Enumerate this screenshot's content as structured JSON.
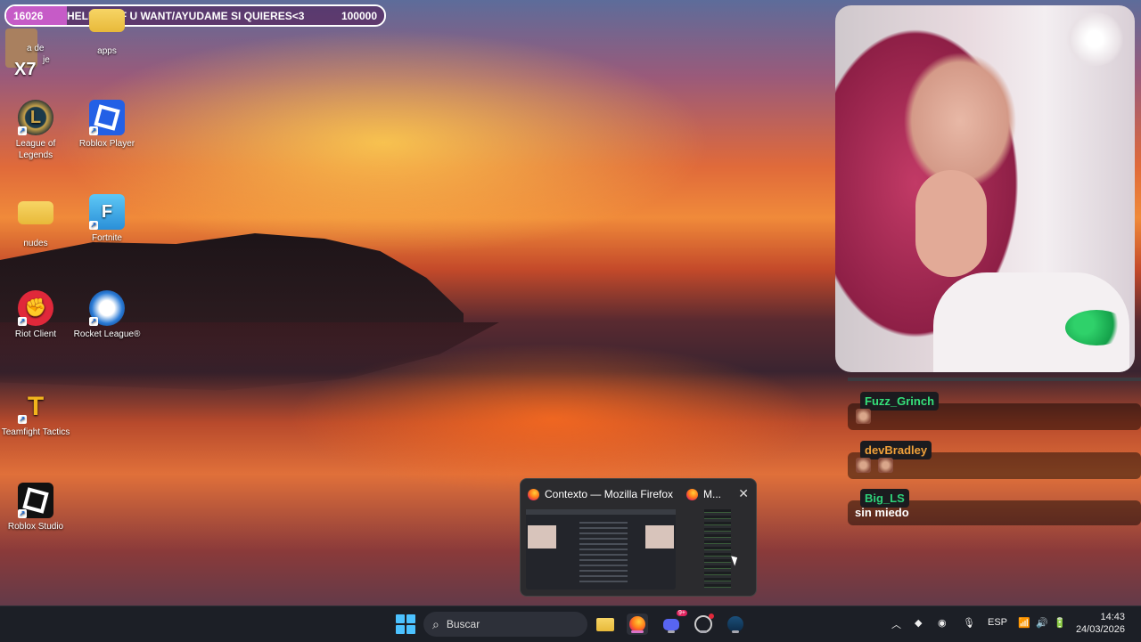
{
  "goal_bar": {
    "current": "16026",
    "text": "HELP ME IF U WANT/AYUDAME SI QUIERES<3",
    "target": "100000",
    "progress_fraction": 0.16026
  },
  "desktop_icons": [
    {
      "label": "apps"
    },
    {
      "label": "League of Legends"
    },
    {
      "label": "Roblox Player"
    },
    {
      "label": "nudes"
    },
    {
      "label": "Fortnite"
    },
    {
      "label": "Riot Client"
    },
    {
      "label": "Rocket League®"
    },
    {
      "label": "Teamfight Tactics"
    },
    {
      "label": "Roblox Studio"
    }
  ],
  "partial_icon": {
    "line1": "a de",
    "line2": "je",
    "overlay": "X7"
  },
  "chat": [
    {
      "user": "Fuzz_Grinch",
      "color": "#35e07a",
      "emotes": 1,
      "text": ""
    },
    {
      "user": "devBradley",
      "color": "#f0a13a",
      "emotes": 2,
      "text": ""
    },
    {
      "user": "Big_LS",
      "color": "#2ed17a",
      "emotes": 0,
      "text": "sin miedo"
    }
  ],
  "preview": {
    "title1": "Contexto — Mozilla Firefox",
    "title2": "M...",
    "close": "✕"
  },
  "taskbar": {
    "search_placeholder": "Buscar",
    "lang": "ESP",
    "time": "14:43",
    "date": "24/03/2026",
    "discord_badge": "9+"
  }
}
